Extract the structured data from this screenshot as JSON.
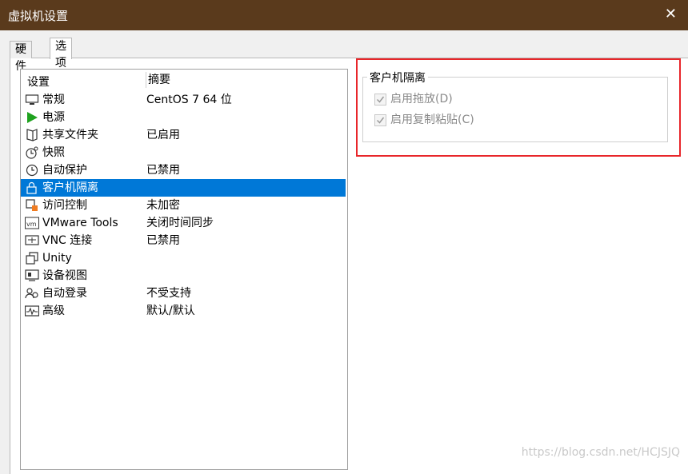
{
  "window": {
    "title": "虚拟机设置",
    "close_glyph": "✕"
  },
  "tabs": [
    {
      "label": "硬件"
    },
    {
      "label": "选项"
    }
  ],
  "list": {
    "headers": {
      "setting": "设置",
      "summary": "摘要"
    },
    "rows": [
      {
        "name": "常规",
        "summary": "CentOS 7 64 位",
        "icon": "monitor-icon"
      },
      {
        "name": "电源",
        "summary": "",
        "icon": "power-play-icon"
      },
      {
        "name": "共享文件夹",
        "summary": "已启用",
        "icon": "shared-folder-icon"
      },
      {
        "name": "快照",
        "summary": "",
        "icon": "snapshot-clock-icon"
      },
      {
        "name": "自动保护",
        "summary": "已禁用",
        "icon": "autoprotect-clock-icon"
      },
      {
        "name": "客户机隔离",
        "summary": "",
        "icon": "lock-icon",
        "selected": true
      },
      {
        "name": "访问控制",
        "summary": "未加密",
        "icon": "access-control-icon"
      },
      {
        "name": "VMware Tools",
        "summary": "关闭时间同步",
        "icon": "vm-icon"
      },
      {
        "name": "VNC 连接",
        "summary": "已禁用",
        "icon": "vnc-icon"
      },
      {
        "name": "Unity",
        "summary": "",
        "icon": "unity-icon"
      },
      {
        "name": "设备视图",
        "summary": "",
        "icon": "device-view-icon"
      },
      {
        "name": "自动登录",
        "summary": "不受支持",
        "icon": "autologin-users-icon"
      },
      {
        "name": "高级",
        "summary": "默认/默认",
        "icon": "advanced-pulse-icon"
      }
    ]
  },
  "isolation": {
    "title": "客户机隔离",
    "drag_drop_label": "启用拖放(D)",
    "copy_paste_label": "启用复制粘贴(C)",
    "drag_drop_checked": true,
    "copy_paste_checked": true
  },
  "watermark": "https://blog.csdn.net/HCJSJQ",
  "colors": {
    "titlebar": "#5a3a1c",
    "selection": "#0078d7",
    "highlight_box": "#e8262a"
  }
}
